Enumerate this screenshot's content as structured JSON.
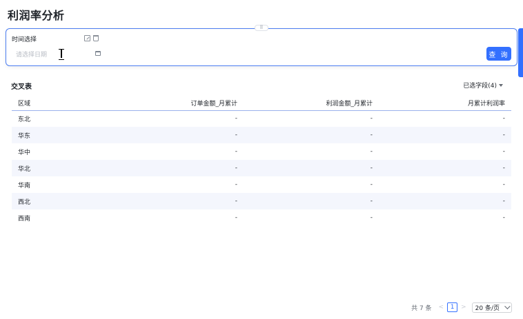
{
  "page": {
    "title": "利润率分析"
  },
  "filter": {
    "label": "时间选择",
    "date_placeholder": "请选择日期",
    "query_button": "查 询"
  },
  "table": {
    "title": "交叉表",
    "field_selector": "已选字段(4)",
    "columns": [
      "区域",
      "订单金额_月累计",
      "利润金额_月累计",
      "月累计利润率"
    ],
    "rows": [
      [
        "东北",
        "-",
        "-",
        "-"
      ],
      [
        "华东",
        "-",
        "-",
        "-"
      ],
      [
        "华中",
        "-",
        "-",
        "-"
      ],
      [
        "华北",
        "-",
        "-",
        "-"
      ],
      [
        "华南",
        "-",
        "-",
        "-"
      ],
      [
        "西北",
        "-",
        "-",
        "-"
      ],
      [
        "西南",
        "-",
        "-",
        "-"
      ]
    ]
  },
  "pagination": {
    "total": "共 7 条",
    "prev": "<",
    "current_page": "1",
    "next": ">",
    "page_size": "20 条/页"
  },
  "colors": {
    "accent": "#3370ff",
    "row_alt": "#f4f6fd"
  }
}
